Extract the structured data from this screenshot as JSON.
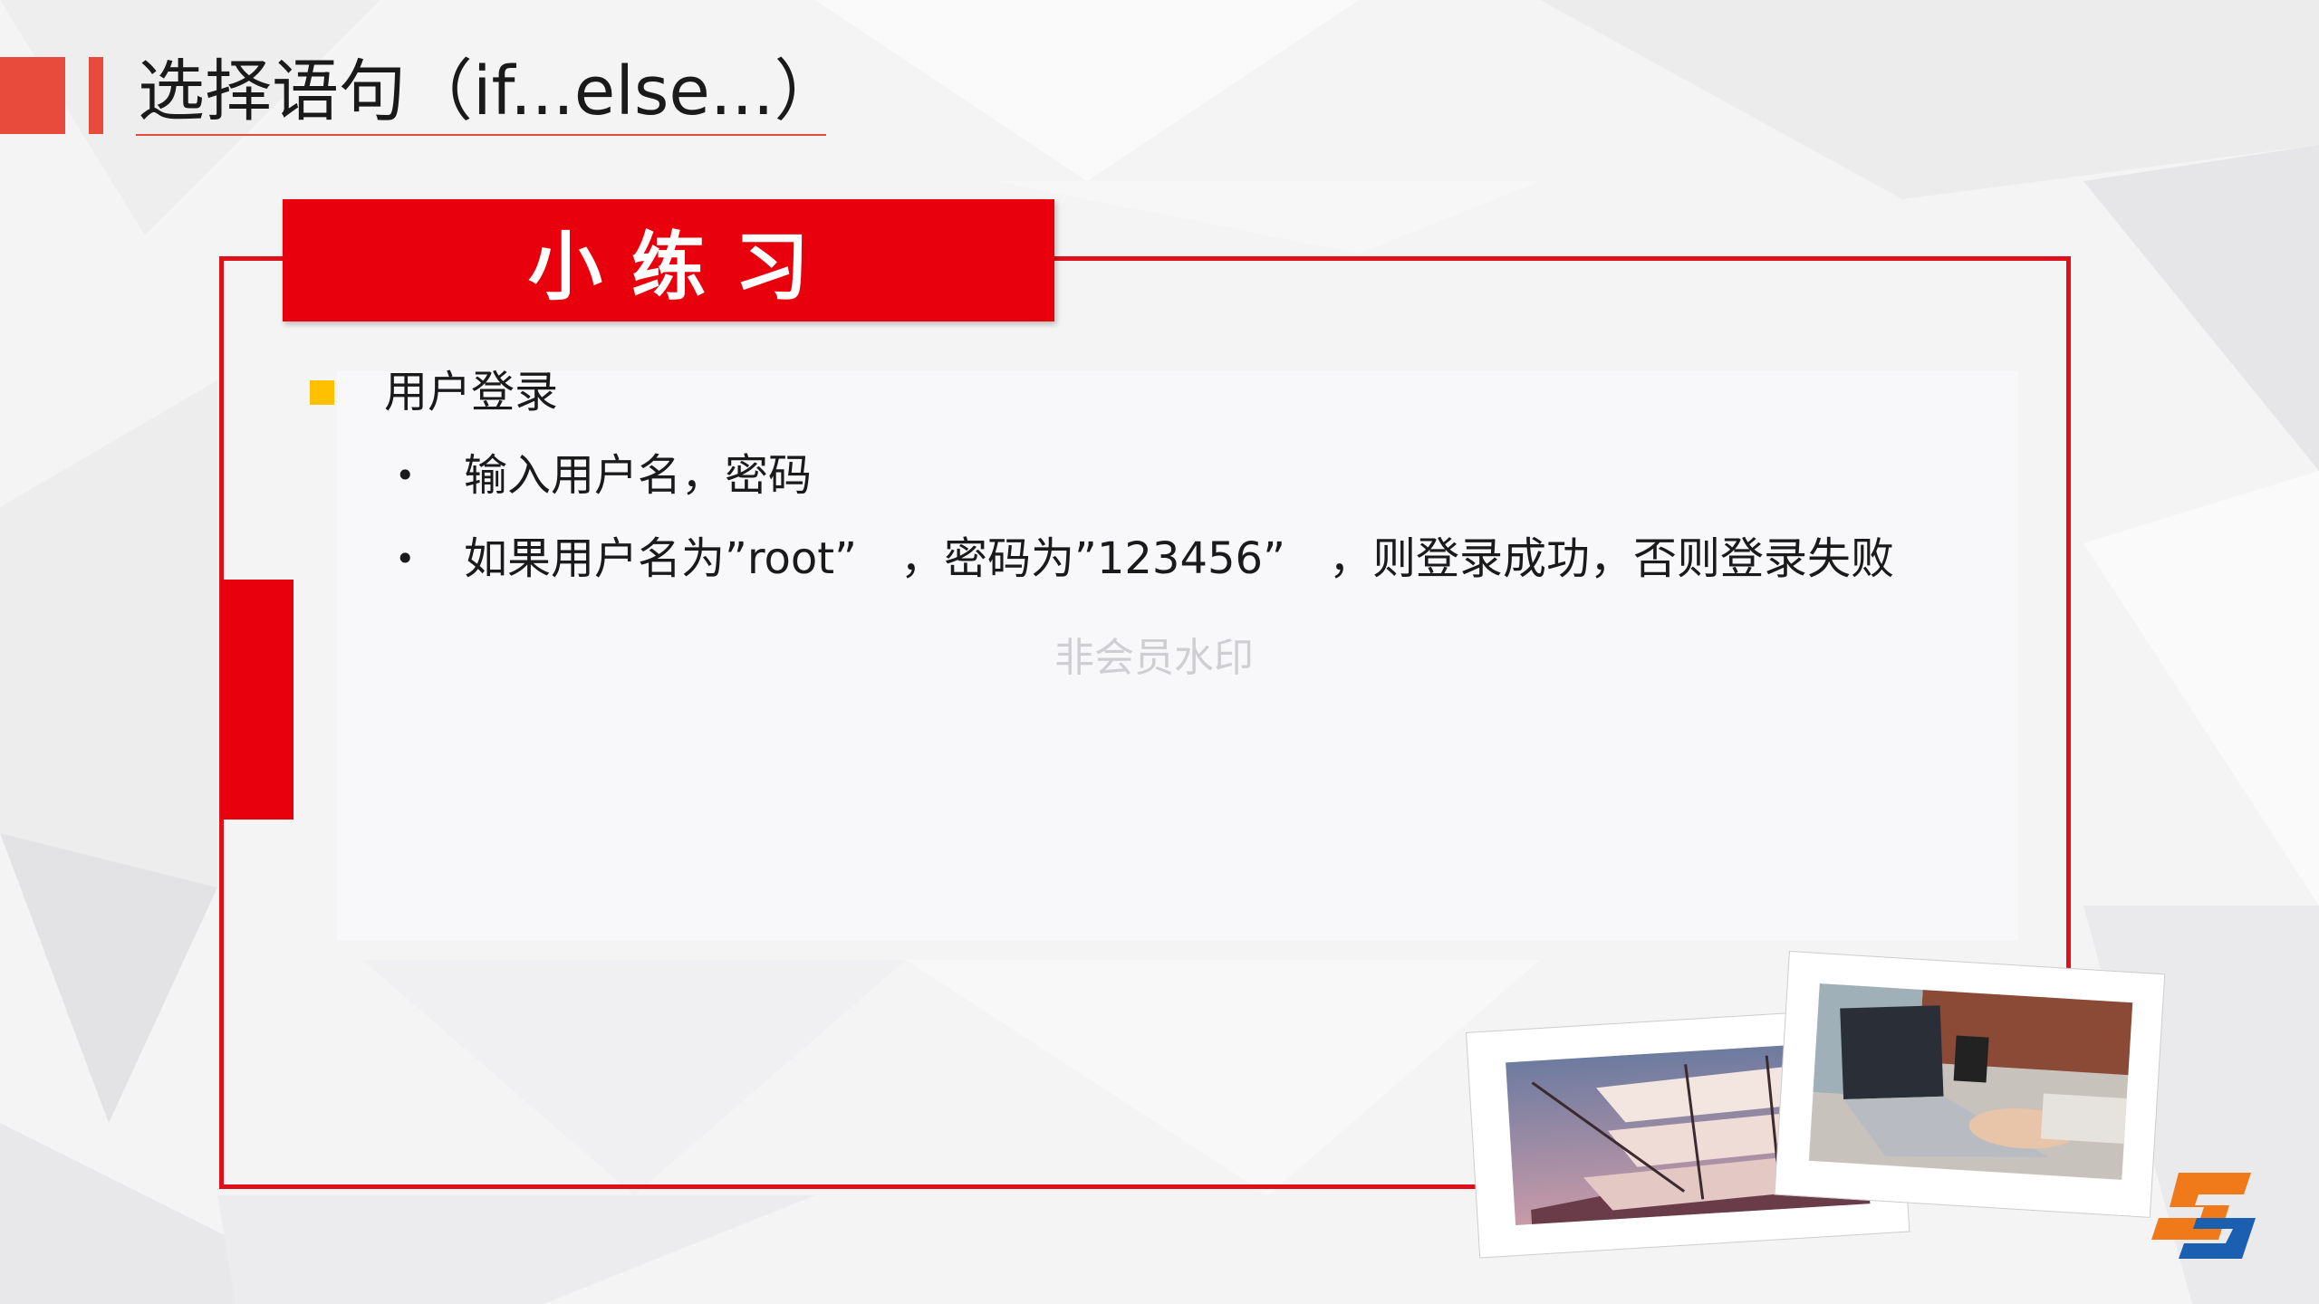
{
  "title": {
    "text": "选择语句（if...else...）"
  },
  "exercise": {
    "header": "小练习",
    "item_title": "用户登录",
    "subitems": [
      "输入用户名，密码",
      "如果用户名为”root”　，密码为”123456”　，则登录成功，否则登录失败"
    ]
  },
  "watermark": "非会员水印",
  "colors": {
    "accent_red": "#e8000c",
    "title_red": "#e84a3c",
    "bullet_yellow": "#ffc000"
  },
  "images": {
    "photo_left": "sailing-ship-model-photo",
    "photo_right": "laptop-typing-photo",
    "logo": "sj-logo"
  }
}
